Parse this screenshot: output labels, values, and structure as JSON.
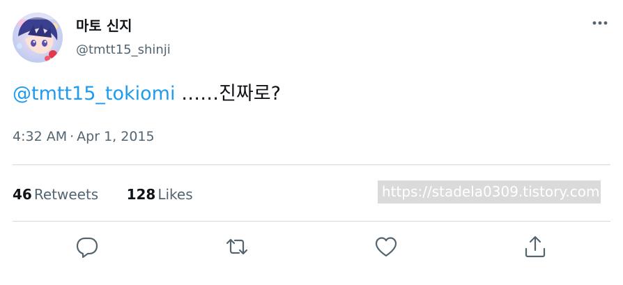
{
  "user": {
    "display_name": "마토 신지",
    "handle": "@tmtt15_shinji",
    "avatar_icon": "avatar-image"
  },
  "tweet": {
    "mention": "@tmtt15_tokiomi",
    "text": " ……진짜로?",
    "time": "4:32 AM",
    "separator": "·",
    "date": "Apr 1, 2015"
  },
  "stats": {
    "retweets_count": "46",
    "retweets_label": "Retweets",
    "likes_count": "128",
    "likes_label": "Likes"
  },
  "watermark": "https://stadela0309.tistory.com",
  "actions": {
    "reply": "reply-icon",
    "retweet": "retweet-icon",
    "like": "heart-icon",
    "share": "share-icon",
    "more": "more-icon"
  },
  "colors": {
    "link": "#1d9bf0",
    "secondary_text": "#536471",
    "divider": "#cfd9de",
    "icon": "#536471"
  }
}
